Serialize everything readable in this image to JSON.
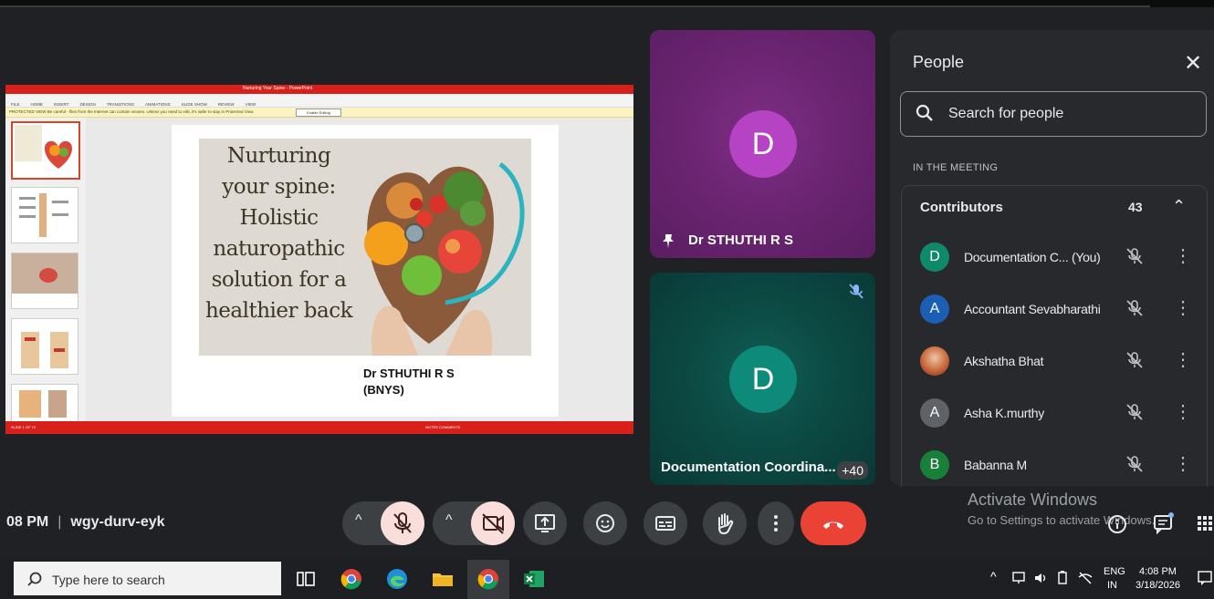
{
  "presentation": {
    "window_title": "Nurturing Your Spine - PowerPoint",
    "ribbon_tabs": [
      "FILE",
      "HOME",
      "INSERT",
      "DESIGN",
      "TRANSITIONS",
      "ANIMATIONS",
      "SLIDE SHOW",
      "REVIEW",
      "VIEW"
    ],
    "warning_text": "PROTECTED VIEW  Be careful - files from the Internet can contain viruses. Unless you need to edit, it's safer to stay in Protected View.",
    "enable_button": "Enable Editing",
    "slide_title": "Nurturing your spine: Holistic naturopathic solution for a healthier back",
    "slide_title_lines": [
      "Nurturing",
      "your spine:",
      "Holistic",
      "naturopathic",
      "solution for a",
      "healthier back"
    ],
    "author_line1": "Dr STHUTHI R S",
    "author_line2": "(BNYS)",
    "status_left": "SLIDE 1 OF 10",
    "status_right": "NOTES  COMMENTS"
  },
  "tiles": [
    {
      "name": "Dr STHUTHI R S",
      "initial": "D",
      "avatar_color": "#b543c4",
      "pinned": true
    },
    {
      "name": "Documentation Coordina...",
      "initial": "D",
      "avatar_color": "#0e8a7b",
      "muted": true,
      "more_count": "+40"
    }
  ],
  "people_panel": {
    "title": "People",
    "search_placeholder": "Search for people",
    "section_label": "IN THE MEETING",
    "group_label": "Contributors",
    "group_count": "43",
    "participants": [
      {
        "name": "Documentation C... (You)",
        "initial": "D",
        "color": "#0e8a6a"
      },
      {
        "name": "Accountant Sevabharathi",
        "initial": "A",
        "color": "#1a5fb4"
      },
      {
        "name": "Akshatha Bhat",
        "initial": "",
        "color": "#b5653b"
      },
      {
        "name": "Asha K.murthy",
        "initial": "A",
        "color": "#5f6368"
      },
      {
        "name": "Babanna M",
        "initial": "B",
        "color": "#188038"
      }
    ]
  },
  "meeting": {
    "time": "08 PM",
    "code": "wgy-durv-eyk"
  },
  "watermark": {
    "line1": "Activate Windows",
    "line2": "Go to Settings to activate Windows."
  },
  "taskbar": {
    "search_placeholder": "Type here to search",
    "lang_line1": "ENG",
    "lang_line2": "IN",
    "clock_time": "4:08 PM",
    "clock_date": "3/18/2026"
  }
}
